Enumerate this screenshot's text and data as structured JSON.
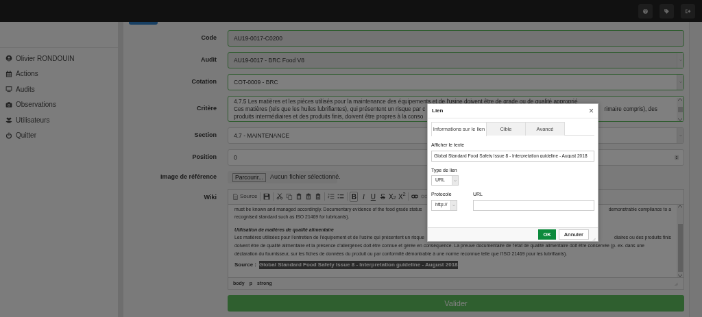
{
  "sidebar": {
    "items": [
      {
        "label": "Olivier RONDOUIN"
      },
      {
        "label": "Actions"
      },
      {
        "label": "Audits"
      },
      {
        "label": "Observations"
      },
      {
        "label": "Utilisateurs"
      },
      {
        "label": "Quitter"
      }
    ]
  },
  "form": {
    "fields": [
      {
        "kind": "text",
        "label": "Code",
        "value": "AU19-0017-C0200",
        "valid": true,
        "disabled": true
      },
      {
        "kind": "select",
        "label": "Audit",
        "value": "AU19-0017 - BRC Food V8",
        "valid": true,
        "disabled": true
      },
      {
        "kind": "select",
        "label": "Cotation",
        "value": "COT-0009 - BRC",
        "valid": true,
        "disabled": false
      },
      {
        "kind": "textarea",
        "label": "Critère",
        "valid": true,
        "disabled": false,
        "lines": [
          [
            "4.7.5 Les matières et les pièces utilisés pour la maintenance des équipements et de l'usine doivent être de grade ou de qualité approprié"
          ],
          [
            "Ces matières (tels que les huiles lubrifiantes), qui présentent un risque par c",
            "rimaire compris), des"
          ],
          [
            "produits intermédiaires et des produits finis, doivent être propres à la conso"
          ]
        ]
      },
      {
        "kind": "select",
        "label": "Section",
        "value": "4.7 - MAINTENANCE",
        "valid": false,
        "disabled": false
      },
      {
        "kind": "number",
        "label": "Position",
        "value": "0",
        "valid": false,
        "disabled": false
      },
      {
        "kind": "file",
        "label": "Image de référence",
        "button": "Parcourir...",
        "value": "Aucun fichier sélectionné."
      },
      {
        "kind": "editor",
        "label": "Wiki",
        "source_label": "Source",
        "format_buttons": [
          {
            "label": "B",
            "active": true
          },
          {
            "label": "I",
            "active": false
          },
          {
            "label": "U",
            "active": false
          },
          {
            "label": "S",
            "active": false
          },
          {
            "label": "X$_{2}$",
            "active": false
          },
          {
            "label": "X$^{2}$",
            "active": false
          }
        ],
        "blocks": [
          {
            "kind": "lines",
            "lines": [
              [
                "must be known and managed accordingly. Documentary evidence of the food grade status",
                "demonstrable compliance to a"
              ],
              [
                "recognised standard such as ISO 21469 for lubricants)."
              ]
            ]
          },
          {
            "kind": "heading",
            "text": "Utilisation de matières de qualité alimentaire"
          },
          {
            "kind": "lines",
            "lines": [
              [
                "Les matières utilisées pour l’entretien de l’équipement et de l’usine qui présentent un risque",
                "diaires ou des produits finis"
              ],
              [
                "doivent être de qualité alimentaire et la présence d’allergènes doit être connue et gérée en conséquence. La preuve documentaire de l’état de qualité alimentaire doit être conservée (p. ex. dans une"
              ],
              [
                "déclaration du fournisseur, sur les fiches de données du produit ou par conformité démontrable à une norme reconnue telle que l’ISO 21469 pour les lubrifiants)."
              ]
            ]
          },
          {
            "kind": "source",
            "label": "Source :",
            "link": "Global Standard Food Safety Issue 8 - Interpretation guideline - August 2018",
            "selected": true
          }
        ],
        "path": [
          "body",
          "p",
          "strong"
        ]
      }
    ],
    "submit": "Valider"
  },
  "dialog": {
    "title": "Lien",
    "close": "×",
    "tabs": [
      {
        "label": "Informations sur le lien",
        "selected": true
      },
      {
        "label": "Cible",
        "selected": false
      },
      {
        "label": "Avancé",
        "selected": false
      }
    ],
    "display_text": {
      "label": "Afficher le texte",
      "value": "Global Standard Food Safety Issue 8 - Interpretation guideline - August 2018"
    },
    "link_type": {
      "label": "Type de lien",
      "value": "URL"
    },
    "protocol": {
      "label": "Protocole",
      "value": "http://"
    },
    "url": {
      "label": "URL"
    },
    "buttons": [
      {
        "label": "OK",
        "primary": true
      },
      {
        "label": "Annuler",
        "primary": false
      }
    ]
  }
}
